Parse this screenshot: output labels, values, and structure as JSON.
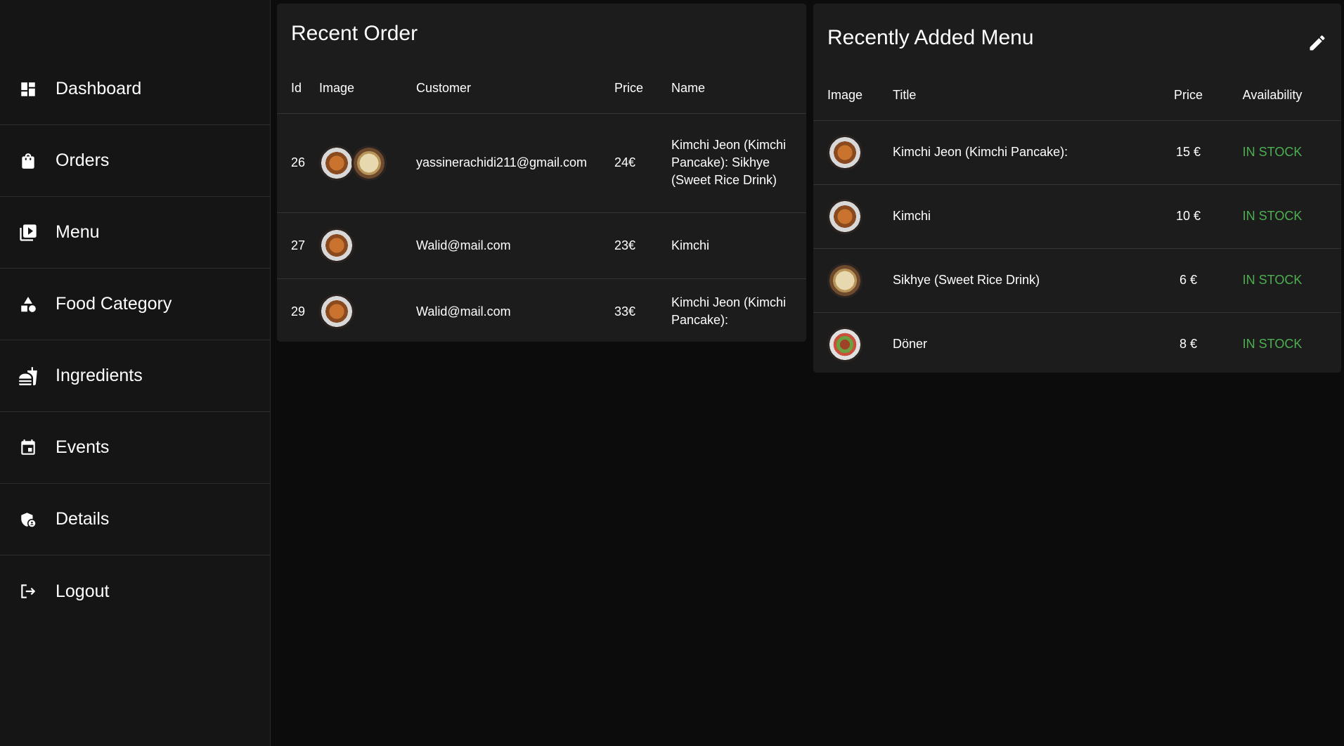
{
  "sidebar": {
    "items": [
      {
        "label": "Dashboard",
        "icon": "dashboard-icon"
      },
      {
        "label": "Orders",
        "icon": "shopping-bag-icon"
      },
      {
        "label": "Menu",
        "icon": "menu-book-icon"
      },
      {
        "label": "Food Category",
        "icon": "category-icon"
      },
      {
        "label": "Ingredients",
        "icon": "ingredients-icon"
      },
      {
        "label": "Events",
        "icon": "calendar-icon"
      },
      {
        "label": "Details",
        "icon": "admin-shield-icon"
      },
      {
        "label": "Logout",
        "icon": "logout-icon"
      }
    ]
  },
  "recent_order": {
    "title": "Recent Order",
    "columns": [
      "Id",
      "Image",
      "Customer",
      "Price",
      "Name"
    ],
    "rows": [
      {
        "id": "26",
        "images": [
          "kimchi-jeon",
          "sikhye"
        ],
        "customer": "yassinerachidi211@gmail.com",
        "price": "24€",
        "name": "Kimchi Jeon (Kimchi Pancake): Sikhye (Sweet Rice Drink)"
      },
      {
        "id": "27",
        "images": [
          "kimchi"
        ],
        "customer": "Walid@mail.com",
        "price": "23€",
        "name": "Kimchi"
      },
      {
        "id": "29",
        "images": [
          "kimchi-jeon"
        ],
        "customer": "Walid@mail.com",
        "price": "33€",
        "name": "Kimchi Jeon (Kimchi Pancake):"
      }
    ]
  },
  "recent_menu": {
    "title": "Recently Added Menu",
    "edit_icon": "edit-pencil-icon",
    "columns": [
      "Image",
      "Title",
      "Price",
      "Availability"
    ],
    "rows": [
      {
        "image": "kimchi-jeon",
        "title": "Kimchi Jeon (Kimchi Pancake):",
        "price": "15 €",
        "availability": "IN STOCK"
      },
      {
        "image": "kimchi",
        "title": "Kimchi",
        "price": "10 €",
        "availability": "IN STOCK"
      },
      {
        "image": "sikhye",
        "title": "Sikhye (Sweet Rice Drink)",
        "price": "6 €",
        "availability": "IN STOCK"
      },
      {
        "image": "doner",
        "title": "Döner",
        "price": "8 €",
        "availability": "IN STOCK"
      }
    ]
  },
  "colors": {
    "background": "#0c0c0c",
    "panel": "#1c1c1c",
    "sidebar": "#151515",
    "in_stock": "#4caf50"
  }
}
